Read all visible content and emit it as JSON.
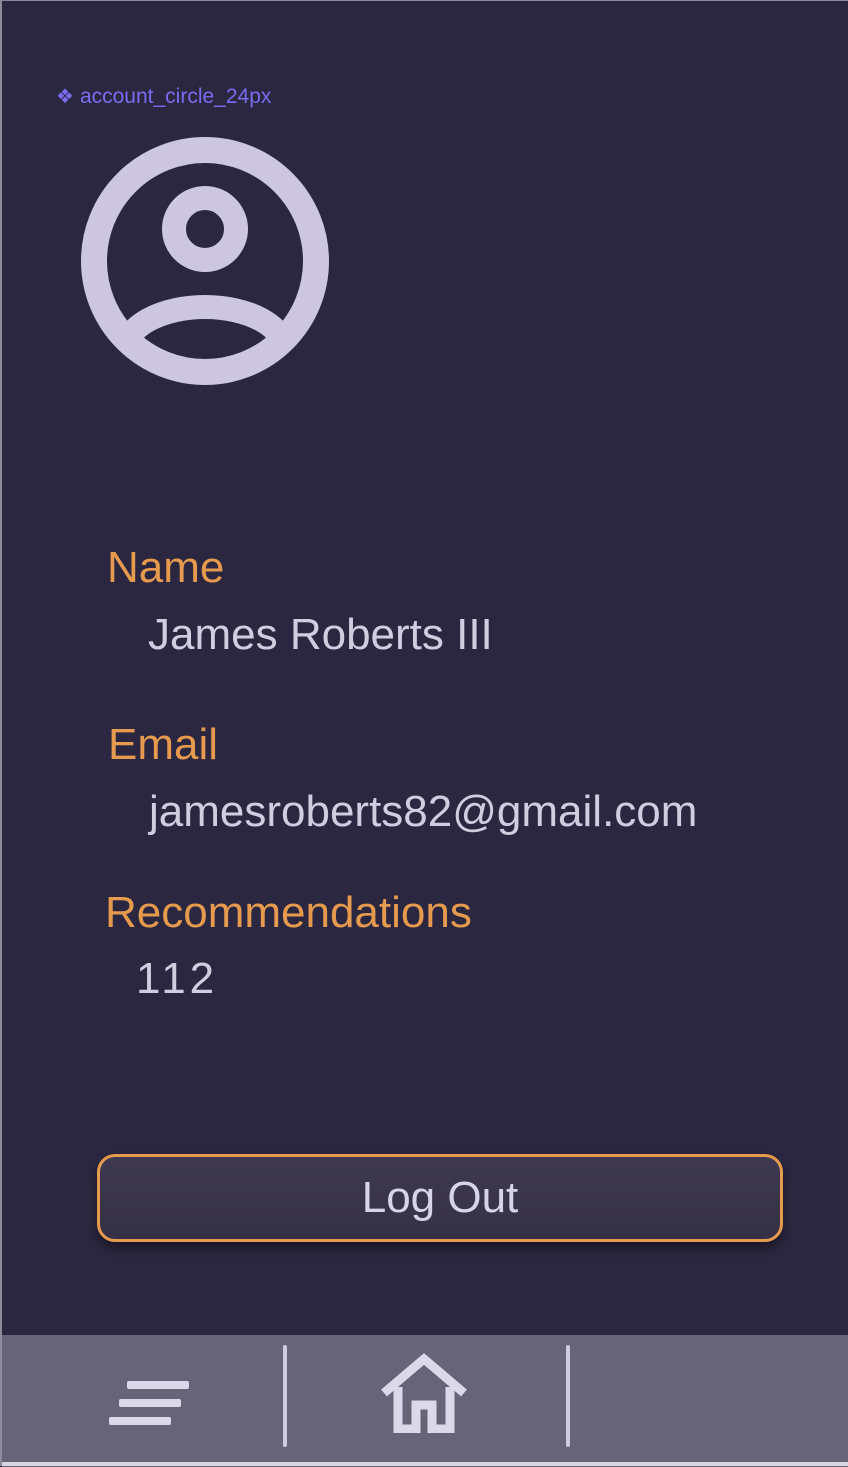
{
  "component_tag": {
    "label": "account_circle_24px",
    "icon": "component-diamond-icon"
  },
  "avatar": {
    "icon": "account-circle-icon",
    "color": "#cdc6e0"
  },
  "profile": {
    "name_label": "Name",
    "name_value": "James Roberts III",
    "email_label": "Email",
    "email_value": "jamesroberts82@gmail.com",
    "recommendations_label": "Recommendations",
    "recommendations_value": "112"
  },
  "actions": {
    "logout_label": "Log Out"
  },
  "bottom_nav": {
    "items": [
      {
        "icon": "menu-icon"
      },
      {
        "icon": "home-icon"
      }
    ]
  },
  "colors": {
    "background": "#2c2740",
    "accent": "#e59a4e",
    "text": "#d0cde0",
    "nav_background": "#67647a",
    "tag": "#7a6cf0"
  }
}
